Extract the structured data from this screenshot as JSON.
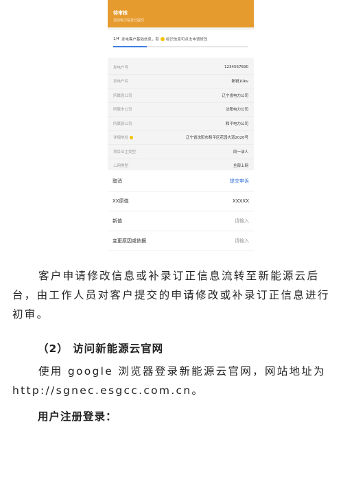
{
  "screenshot": {
    "header_title": "待审核",
    "header_subtitle": "当前电力信息已提交",
    "step": "1/4",
    "step_text": "发电客户基础信息，有",
    "step_text2": "标识信息可点击申请修改",
    "progress": 0.25,
    "fields": [
      {
        "label": "发电户号",
        "value": "1234567690"
      },
      {
        "label": "发电户名",
        "value": "新锐10kv"
      },
      {
        "label": "所属省公司",
        "value": "辽宁省电力公司"
      },
      {
        "label": "所属市公司",
        "value": "沈阳电力公司"
      },
      {
        "label": "所属县公司",
        "value": "和平电力公司"
      },
      {
        "label": "详细地址",
        "value": "辽宁省沈阳市和平区花园大道2020号",
        "marked": true
      },
      {
        "label": "项目业主类型",
        "value": "同一法人"
      },
      {
        "label": "上网类型",
        "value": "全部上网"
      }
    ]
  },
  "form": {
    "cancel_label": "取消",
    "submit_label": "提交申诉",
    "rows": [
      {
        "label": "XX原值",
        "value": "XXXXX"
      },
      {
        "label": "新值",
        "placeholder": "请输入"
      },
      {
        "label": "变更原因或依据",
        "placeholder": "请输入"
      }
    ]
  },
  "document": {
    "paragraph1": "客户申请修改信息或补录订正信息流转至新能源云后台，由工作人员对客户提交的申请修改或补录订正信息进行初审。",
    "heading1": "（2）  访问新能源云官网",
    "paragraph2": "使用 google 浏览器登录新能源云官网，网站地址为http://sgnec.esgcc.com.cn。",
    "heading2": "用户注册登录："
  }
}
